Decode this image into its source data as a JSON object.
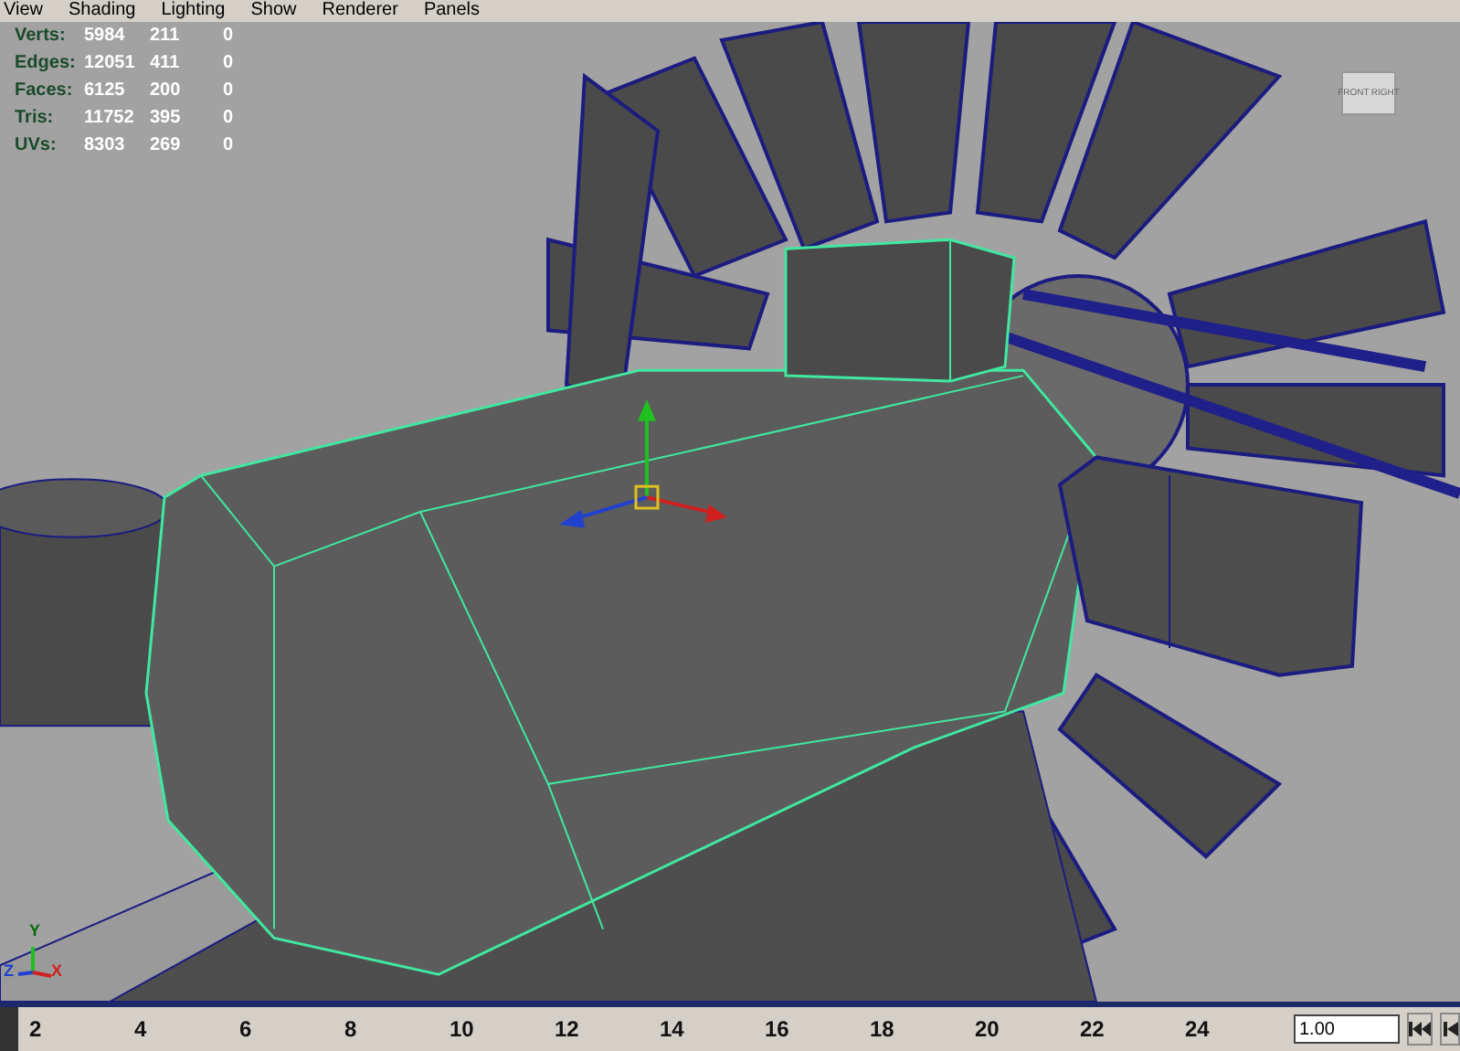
{
  "menu": [
    "View",
    "Shading",
    "Lighting",
    "Show",
    "Renderer",
    "Panels"
  ],
  "stats": [
    {
      "label": "Verts:",
      "values": [
        "5984",
        "211",
        "0"
      ]
    },
    {
      "label": "Edges:",
      "values": [
        "12051",
        "411",
        "0"
      ]
    },
    {
      "label": "Faces:",
      "values": [
        "6125",
        "200",
        "0"
      ]
    },
    {
      "label": "Tris:",
      "values": [
        "11752",
        "395",
        "0"
      ]
    },
    {
      "label": "UVs:",
      "values": [
        "8303",
        "269",
        "0"
      ]
    }
  ],
  "view_cube": [
    "FRONT",
    "RIGHT"
  ],
  "axis_labels": [
    "Y",
    "Z",
    "X"
  ],
  "timeline": {
    "level": 0,
    "ticks": [
      "2",
      "4",
      "6",
      "8",
      "10",
      "12",
      "14",
      "16",
      "18",
      "20",
      "22",
      "24"
    ],
    "time_field": "1.00"
  }
}
